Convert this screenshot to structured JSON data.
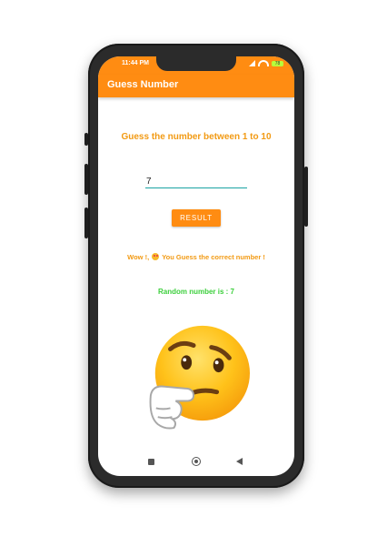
{
  "status_bar": {
    "time": "11:44 PM",
    "battery": "78"
  },
  "app_bar": {
    "title": "Guess Number"
  },
  "main": {
    "prompt": "Guess the number between 1 to 10",
    "input_value": "7",
    "result_button_label": "RESULT",
    "result_prefix": "Wow !,",
    "result_emoji": "smiling-face-with-heart-eyes",
    "result_suffix": "You Guess the correct number !",
    "random_number_text": "Random number is : 7",
    "illustration": "thinking-face-emoji"
  },
  "nav_bar": {
    "icons": [
      "recent-apps-icon",
      "home-icon",
      "back-icon"
    ]
  },
  "colors": {
    "app_bar": "#ff8c12",
    "prompt_text": "#f29a13",
    "random_text": "#3ccf3c",
    "input_underline": "#1aa3a3"
  }
}
